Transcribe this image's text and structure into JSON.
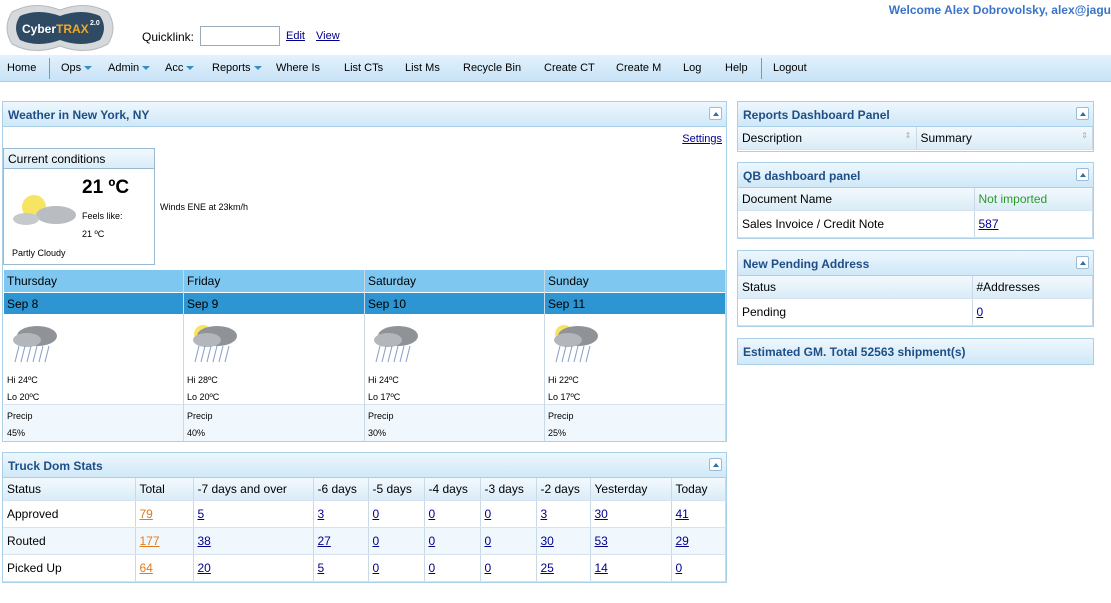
{
  "header": {
    "logo_text": "CyberTRAX",
    "logo_version": "2.0",
    "quicklink_label": "Quicklink:",
    "quicklink_value": "",
    "edit_link": "Edit",
    "view_link": "View",
    "welcome": "Welcome Alex Dobrovolsky, alex@jagu"
  },
  "nav": [
    {
      "label": "Home"
    },
    {
      "label": "Ops",
      "dropdown": true
    },
    {
      "label": "Admin",
      "dropdown": true
    },
    {
      "label": "Acc",
      "dropdown": true
    },
    {
      "label": "Reports",
      "dropdown": true
    },
    {
      "label": "Where Is"
    },
    {
      "label": "List CTs"
    },
    {
      "label": "List Ms"
    },
    {
      "label": "Recycle Bin"
    },
    {
      "label": "Create CT"
    },
    {
      "label": "Create M"
    },
    {
      "label": "Log"
    },
    {
      "label": "Help"
    },
    {
      "label": "Logout"
    }
  ],
  "weather": {
    "title": "Weather in New York, NY",
    "settings": "Settings",
    "current_title": "Current conditions",
    "temp": "21 ºC",
    "feels_label": "Feels like:",
    "feels": "21 ºC",
    "condition": "Partly Cloudy",
    "wind": "Winds ENE at 23km/h",
    "days": [
      {
        "day": "Thursday",
        "date": "Sep 8",
        "hi": "Hi 24ºC",
        "lo": "Lo 20ºC",
        "precip_label": "Precip",
        "precip": "45%",
        "icon": "rain-icon"
      },
      {
        "day": "Friday",
        "date": "Sep 9",
        "hi": "Hi 28ºC",
        "lo": "Lo 20ºC",
        "precip_label": "Precip",
        "precip": "40%",
        "icon": "thunderstorm-sun-icon"
      },
      {
        "day": "Saturday",
        "date": "Sep 10",
        "hi": "Hi 24ºC",
        "lo": "Lo 17ºC",
        "precip_label": "Precip",
        "precip": "30%",
        "icon": "thunderstorm-icon"
      },
      {
        "day": "Sunday",
        "date": "Sep 11",
        "hi": "Hi 22ºC",
        "lo": "Lo 17ºC",
        "precip_label": "Precip",
        "precip": "25%",
        "icon": "thunderstorm-sun-icon"
      }
    ]
  },
  "truck": {
    "title": "Truck Dom Stats",
    "headers": [
      "Status",
      "Total",
      "-7 days and over",
      "-6 days",
      "-5 days",
      "-4 days",
      "-3 days",
      "-2 days",
      "Yesterday",
      "Today"
    ],
    "rows": [
      [
        "Approved",
        "79",
        "5",
        "3",
        "0",
        "0",
        "0",
        "3",
        "30",
        "41"
      ],
      [
        "Routed",
        "177",
        "38",
        "27",
        "0",
        "0",
        "0",
        "30",
        "53",
        "29"
      ],
      [
        "Picked Up",
        "64",
        "20",
        "5",
        "0",
        "0",
        "0",
        "25",
        "14",
        "0"
      ]
    ]
  },
  "reports_panel": {
    "title": "Reports Dashboard Panel",
    "headers": [
      "Description",
      "Summary"
    ]
  },
  "qb_panel": {
    "title": "QB dashboard panel",
    "headers": [
      "Document Name",
      "Not imported"
    ],
    "rows": [
      [
        "Sales Invoice / Credit Note",
        "587"
      ]
    ]
  },
  "pending_panel": {
    "title": "New Pending Address",
    "headers": [
      "Status",
      "#Addresses"
    ],
    "rows": [
      [
        "Pending",
        "0"
      ]
    ]
  },
  "gm_panel": {
    "title": "Estimated GM. Total 52563 shipment(s)"
  },
  "colors": {
    "accent": "#1f4e86",
    "day_header": "#7ec7f1",
    "date_header": "#2d96d2",
    "total_link": "#e07b1f",
    "not_imported": "#2a9a2a"
  }
}
